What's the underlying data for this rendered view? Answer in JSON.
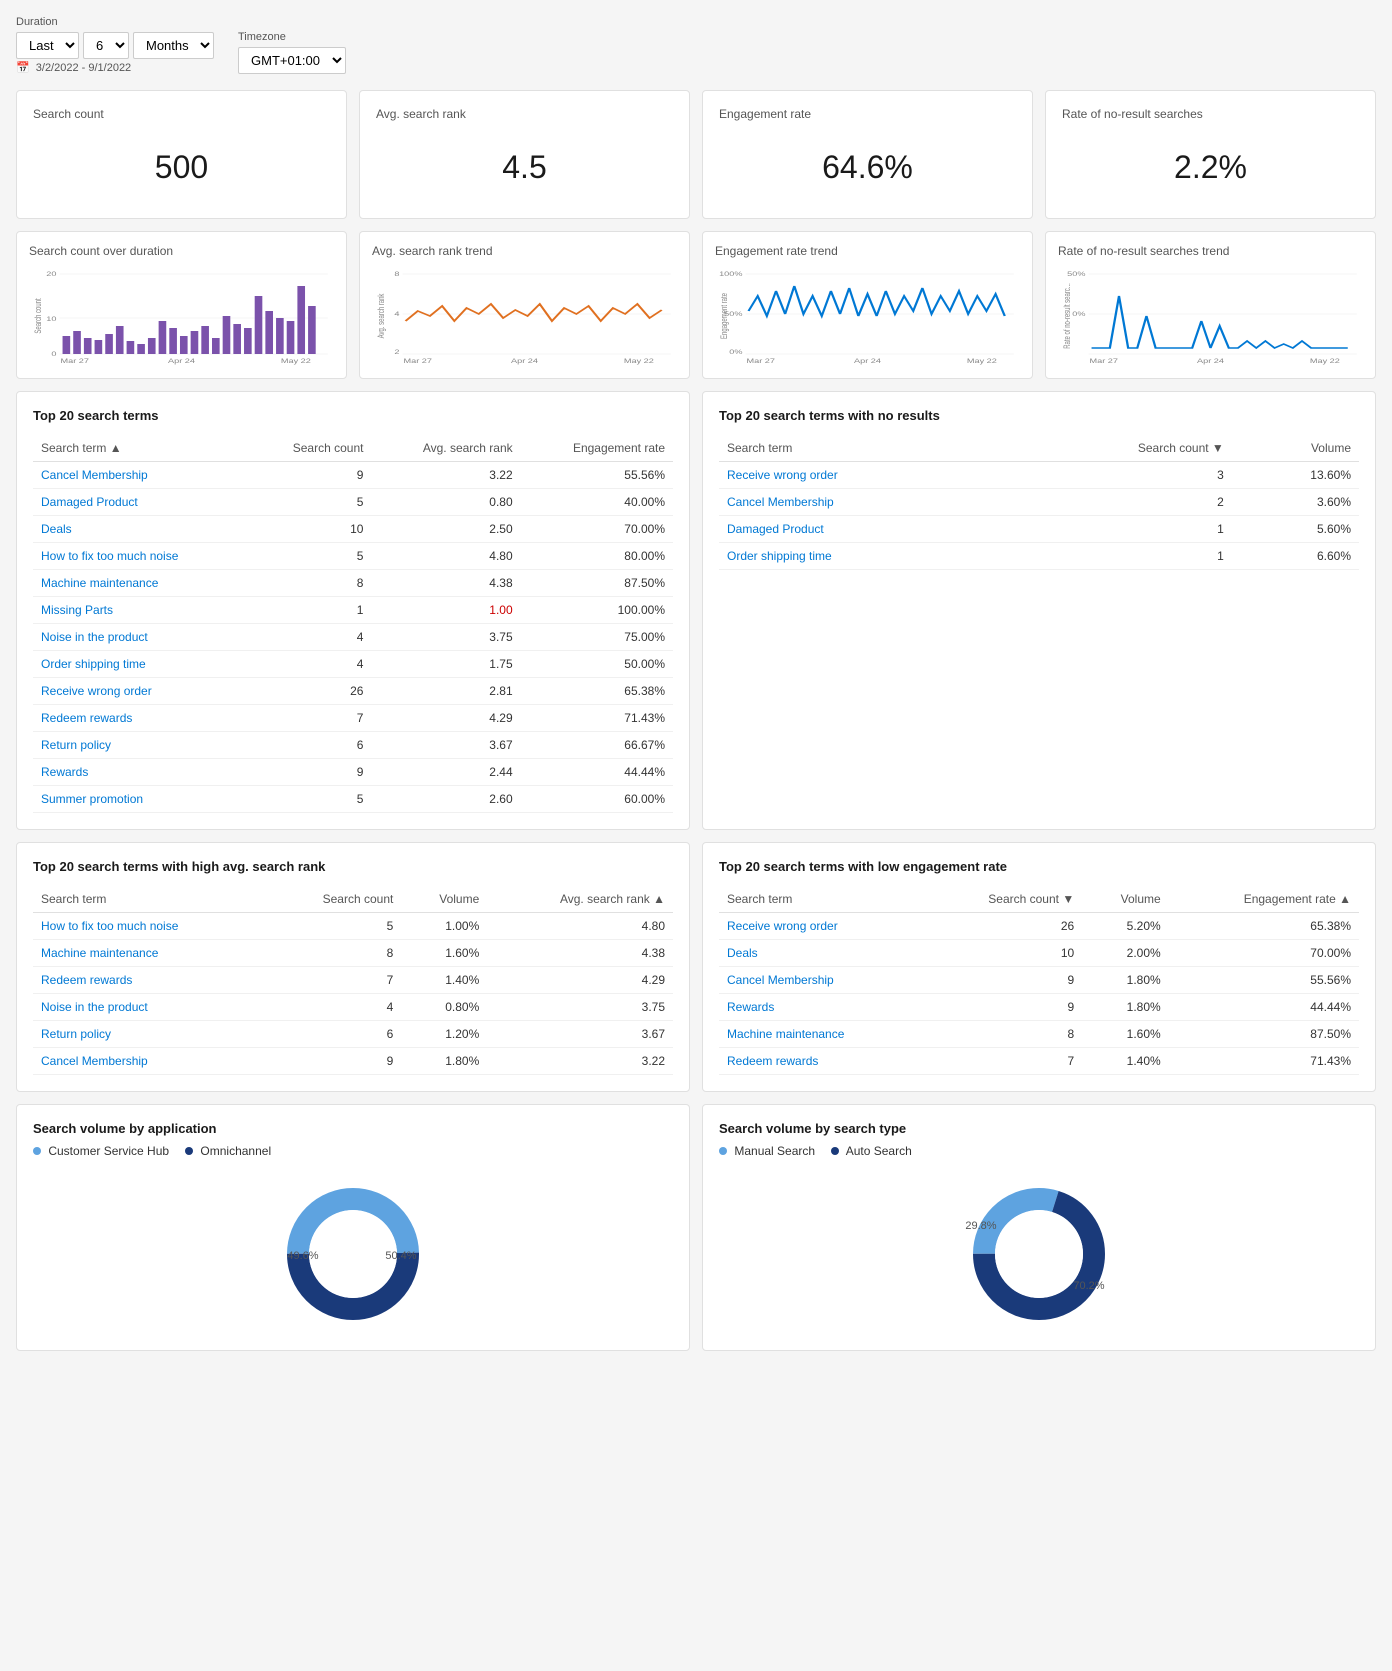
{
  "filters": {
    "duration_label": "Duration",
    "timezone_label": "Timezone",
    "last_label": "Last",
    "months_value": "6",
    "period_label": "Months",
    "timezone_value": "GMT+01:00",
    "date_range": "3/2/2022 - 9/1/2022"
  },
  "kpis": [
    {
      "title": "Search count",
      "value": "500"
    },
    {
      "title": "Avg. search rank",
      "value": "4.5"
    },
    {
      "title": "Engagement rate",
      "value": "64.6%"
    },
    {
      "title": "Rate of no-result searches",
      "value": "2.2%"
    }
  ],
  "charts": [
    {
      "title": "Search count over duration",
      "type": "bar",
      "color": "#7b52ab",
      "y_label": "Search count",
      "x_labels": [
        "Mar 27",
        "Apr 24",
        "May 22"
      ],
      "y_max": 20
    },
    {
      "title": "Avg. search rank trend",
      "type": "line",
      "color": "#e07020",
      "y_label": "Avg. search rank",
      "x_labels": [
        "Mar 27",
        "Apr 24",
        "May 22"
      ],
      "y_max": 8
    },
    {
      "title": "Engagement rate trend",
      "type": "line",
      "color": "#0078d4",
      "y_label": "Engagement rate",
      "x_labels": [
        "Mar 27",
        "Apr 24",
        "May 22"
      ],
      "y_max": 100
    },
    {
      "title": "Rate of no-result searches trend",
      "type": "line",
      "color": "#0078d4",
      "y_label": "Rate of no-result searc...",
      "x_labels": [
        "Mar 27",
        "Apr 24",
        "May 22"
      ],
      "y_max": 50
    }
  ],
  "top20_table": {
    "title": "Top 20 search terms",
    "columns": [
      "Search term",
      "Search count",
      "Avg. search rank",
      "Engagement rate"
    ],
    "rows": [
      [
        "Cancel Membership",
        "9",
        "3.22",
        "55.56%"
      ],
      [
        "Damaged Product",
        "5",
        "0.80",
        "40.00%"
      ],
      [
        "Deals",
        "10",
        "2.50",
        "70.00%"
      ],
      [
        "How to fix too much noise",
        "5",
        "4.80",
        "80.00%"
      ],
      [
        "Machine maintenance",
        "8",
        "4.38",
        "87.50%"
      ],
      [
        "Missing Parts",
        "1",
        "1.00",
        "100.00%"
      ],
      [
        "Noise in the product",
        "4",
        "3.75",
        "75.00%"
      ],
      [
        "Order shipping time",
        "4",
        "1.75",
        "50.00%"
      ],
      [
        "Receive wrong order",
        "26",
        "2.81",
        "65.38%"
      ],
      [
        "Redeem rewards",
        "7",
        "4.29",
        "71.43%"
      ],
      [
        "Return policy",
        "6",
        "3.67",
        "66.67%"
      ],
      [
        "Rewards",
        "9",
        "2.44",
        "44.44%"
      ],
      [
        "Summer promotion",
        "5",
        "2.60",
        "60.00%"
      ]
    ]
  },
  "no_results_table": {
    "title": "Top 20 search terms with no results",
    "columns": [
      "Search term",
      "Search count",
      "Volume"
    ],
    "rows": [
      [
        "Receive wrong order",
        "3",
        "13.60%"
      ],
      [
        "Cancel Membership",
        "2",
        "3.60%"
      ],
      [
        "Damaged Product",
        "1",
        "5.60%"
      ],
      [
        "Order shipping time",
        "1",
        "6.60%"
      ]
    ]
  },
  "high_rank_table": {
    "title": "Top 20 search terms with high avg. search rank",
    "columns": [
      "Search term",
      "Search count",
      "Volume",
      "Avg. search rank"
    ],
    "rows": [
      [
        "How to fix too much noise",
        "5",
        "1.00%",
        "4.80"
      ],
      [
        "Machine maintenance",
        "8",
        "1.60%",
        "4.38"
      ],
      [
        "Redeem rewards",
        "7",
        "1.40%",
        "4.29"
      ],
      [
        "Noise in the product",
        "4",
        "0.80%",
        "3.75"
      ],
      [
        "Return policy",
        "6",
        "1.20%",
        "3.67"
      ],
      [
        "Cancel Membership",
        "9",
        "1.80%",
        "3.22"
      ]
    ]
  },
  "low_engagement_table": {
    "title": "Top 20 search terms with low engagement rate",
    "columns": [
      "Search term",
      "Search count",
      "Volume",
      "Engagement rate"
    ],
    "rows": [
      [
        "Receive wrong order",
        "26",
        "5.20%",
        "65.38%"
      ],
      [
        "Deals",
        "10",
        "2.00%",
        "70.00%"
      ],
      [
        "Cancel Membership",
        "9",
        "1.80%",
        "55.56%"
      ],
      [
        "Rewards",
        "9",
        "1.80%",
        "44.44%"
      ],
      [
        "Machine maintenance",
        "8",
        "1.60%",
        "87.50%"
      ],
      [
        "Redeem rewards",
        "7",
        "1.40%",
        "71.43%"
      ]
    ]
  },
  "donut_app": {
    "title": "Search volume by application",
    "legend": [
      {
        "label": "Customer Service Hub",
        "color": "#5ea3e0"
      },
      {
        "label": "Omnichannel",
        "color": "#1a3a7a"
      }
    ],
    "segments": [
      {
        "label": "49.6%",
        "value": 49.6,
        "color": "#5ea3e0"
      },
      {
        "label": "50.4%",
        "value": 50.4,
        "color": "#1a3a7a"
      }
    ]
  },
  "donut_type": {
    "title": "Search volume by search type",
    "legend": [
      {
        "label": "Manual Search",
        "color": "#5ea3e0"
      },
      {
        "label": "Auto Search",
        "color": "#1a3a7a"
      }
    ],
    "segments": [
      {
        "label": "29.8%",
        "value": 29.8,
        "color": "#5ea3e0"
      },
      {
        "label": "70.2%",
        "value": 70.2,
        "color": "#1a3a7a"
      }
    ]
  }
}
